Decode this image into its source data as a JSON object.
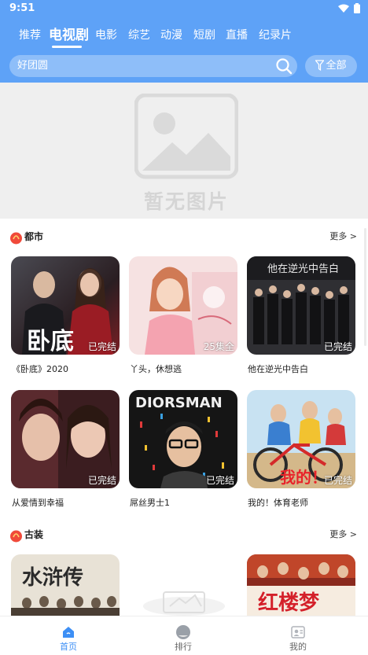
{
  "status_bar": {
    "time": "9:51"
  },
  "tabs": [
    {
      "label": "推荐"
    },
    {
      "label": "电视剧"
    },
    {
      "label": "电影"
    },
    {
      "label": "综艺"
    },
    {
      "label": "动漫"
    },
    {
      "label": "短剧"
    },
    {
      "label": "直播"
    },
    {
      "label": "纪录片"
    }
  ],
  "active_tab": "电视剧",
  "search": {
    "value": "好团圆",
    "all_label": "全部"
  },
  "banner": {
    "placeholder_text": "暂无图片"
  },
  "sections": [
    {
      "title": "都市",
      "more": "更多 >",
      "items": [
        {
          "title": "《卧底》2020",
          "status": "已完结",
          "poster_text": "卧底"
        },
        {
          "title": "丫头，休想逃",
          "status": "25集全"
        },
        {
          "title": "他在逆光中告白",
          "status": "已完结",
          "poster_text": "他在逆光中告白"
        },
        {
          "title": "从爱情到幸福",
          "status": "已完结"
        },
        {
          "title": "屌丝男士1",
          "status": "已完结",
          "poster_text": "DIORSMAN"
        },
        {
          "title": "我的！体育老师",
          "status": "已完结",
          "poster_text": "我的！"
        }
      ]
    },
    {
      "title": "古装",
      "more": "更多 >",
      "items": [
        {
          "poster_text": "水浒传"
        },
        {},
        {
          "poster_text": "红楼梦"
        }
      ]
    }
  ],
  "bottom_nav": [
    {
      "label": "首页"
    },
    {
      "label": "排行"
    },
    {
      "label": "我的"
    }
  ],
  "colors": {
    "accent": "#5ea2f7",
    "nav_active": "#3d8ff5",
    "section_icon": "#f04a3a"
  }
}
